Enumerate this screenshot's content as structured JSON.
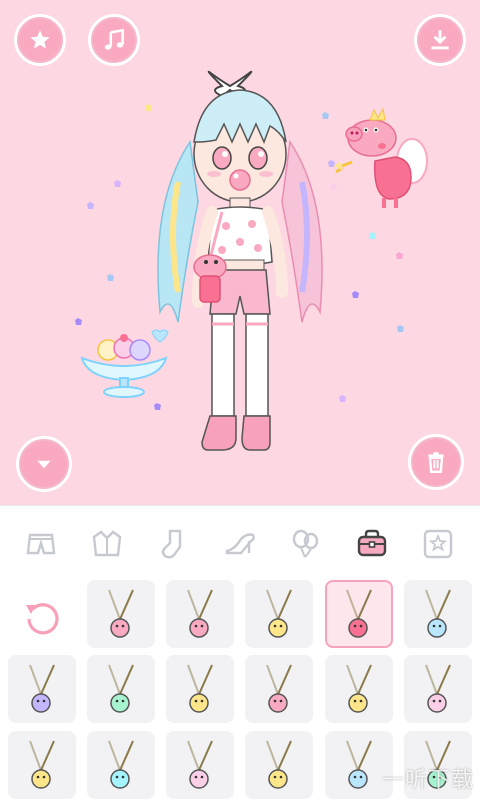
{
  "colors": {
    "stage_bg": "#fdd7e1",
    "accent_pink": "#f9a9c0",
    "selected_border": "#f6a3bb",
    "panel_bg": "#ffffff",
    "cell_bg": "#f2f2f4"
  },
  "top_buttons": [
    {
      "name": "favorites",
      "icon": "star-icon"
    },
    {
      "name": "music",
      "icon": "music-note-icon"
    },
    {
      "name": "download",
      "icon": "download-icon"
    }
  ],
  "bottom_buttons": [
    {
      "name": "collapse",
      "icon": "chevron-down-icon"
    },
    {
      "name": "clear",
      "icon": "trash-icon"
    }
  ],
  "categories": [
    {
      "id": "bottoms",
      "icon": "shorts-icon",
      "active": false
    },
    {
      "id": "outerwear",
      "icon": "jacket-icon",
      "active": false
    },
    {
      "id": "socks",
      "icon": "sock-icon",
      "active": false
    },
    {
      "id": "shoes",
      "icon": "heel-shoe-icon",
      "active": false
    },
    {
      "id": "props",
      "icon": "balloons-icon",
      "active": false
    },
    {
      "id": "bags",
      "icon": "bag-icon",
      "active": true
    },
    {
      "id": "backgrounds",
      "icon": "star-frame-icon",
      "active": false
    }
  ],
  "items_grid": {
    "reset_icon": "undo-icon",
    "selected_index": 3,
    "items": [
      {
        "icon": "bear-bag-icon"
      },
      {
        "icon": "flower-bag-icon"
      },
      {
        "icon": "cat-bag-icon"
      },
      {
        "icon": "peppa-bag-icon"
      },
      {
        "icon": "cup-bag-icon"
      },
      {
        "icon": "bottle-bag-icon"
      },
      {
        "icon": "milk-box-bag-icon"
      },
      {
        "icon": "bow-clutch-icon"
      },
      {
        "icon": "pink-round-bag-icon"
      },
      {
        "icon": "heart-bag-icon"
      },
      {
        "icon": "bunny-bag-icon"
      },
      {
        "icon": "lemon-bag-icon"
      },
      {
        "icon": "candy-bag-icon"
      },
      {
        "icon": "strawberry-bag-icon"
      },
      {
        "icon": "face-bag-icon"
      },
      {
        "icon": "fish-bag-icon"
      },
      {
        "icon": "watermelon-bag-icon"
      }
    ]
  },
  "watermark": "一听下载"
}
